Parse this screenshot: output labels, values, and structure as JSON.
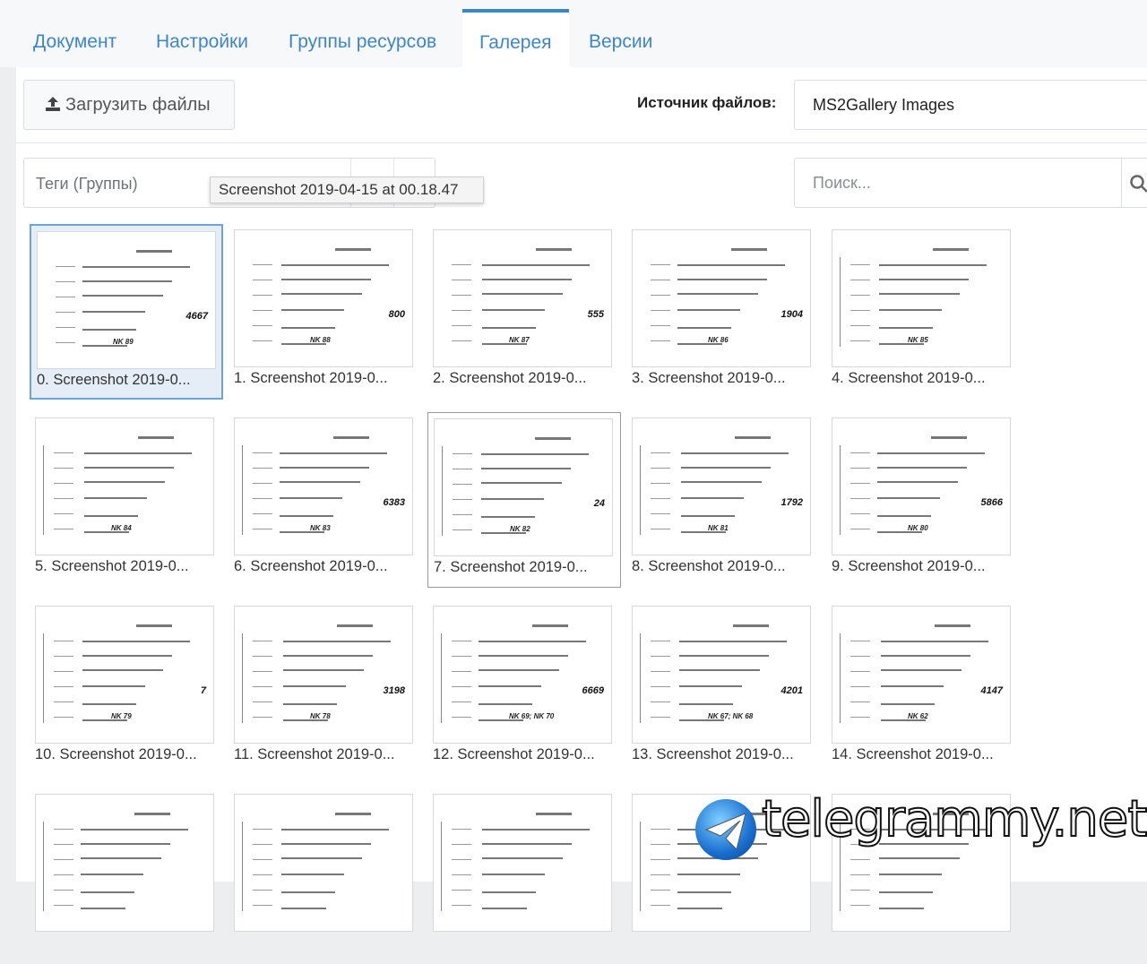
{
  "tabs": [
    {
      "label": "Документ"
    },
    {
      "label": "Настройки"
    },
    {
      "label": "Группы ресурсов"
    },
    {
      "label": "Галерея"
    },
    {
      "label": "Версии"
    }
  ],
  "toolbar": {
    "upload_label": "Загрузить файлы",
    "source_label": "Источник файлов:",
    "source_value": "MS2Gallery Images"
  },
  "filters": {
    "tags_placeholder": "Теги (Группы)",
    "search_placeholder": "Поиск..."
  },
  "tooltip": "Screenshot 2019-04-15 at 00.18.47",
  "gallery": {
    "items": [
      {
        "caption": "0. Screenshot 2019-0...",
        "code": "NK 89",
        "num": "4667"
      },
      {
        "caption": "1. Screenshot 2019-0...",
        "code": "NK 88",
        "num": "800"
      },
      {
        "caption": "2. Screenshot 2019-0...",
        "code": "NK 87",
        "num": "555"
      },
      {
        "caption": "3. Screenshot 2019-0...",
        "code": "NK 86",
        "num": "1904"
      },
      {
        "caption": "4. Screenshot 2019-0...",
        "code": "NK 85",
        "num": ""
      },
      {
        "caption": "5. Screenshot 2019-0...",
        "code": "NK 84",
        "num": ""
      },
      {
        "caption": "6. Screenshot 2019-0...",
        "code": "NK 83",
        "num": "6383"
      },
      {
        "caption": "7. Screenshot 2019-0...",
        "code": "NK 82",
        "num": "24"
      },
      {
        "caption": "8. Screenshot 2019-0...",
        "code": "NK 81",
        "num": "1792"
      },
      {
        "caption": "9. Screenshot 2019-0...",
        "code": "NK 80",
        "num": "5866"
      },
      {
        "caption": "10. Screenshot 2019-0...",
        "code": "NK 79",
        "num": "7"
      },
      {
        "caption": "11. Screenshot 2019-0...",
        "code": "NK 78",
        "num": "3198"
      },
      {
        "caption": "12. Screenshot 2019-0...",
        "code": "NK 69; NK 70",
        "num": "6669"
      },
      {
        "caption": "13. Screenshot 2019-0...",
        "code": "NK 67; NK 68",
        "num": "4201"
      },
      {
        "caption": "14. Screenshot 2019-0...",
        "code": "NK 62",
        "num": "4147"
      },
      {
        "caption": "",
        "code": "",
        "num": ""
      },
      {
        "caption": "",
        "code": "",
        "num": ""
      },
      {
        "caption": "",
        "code": "",
        "num": ""
      },
      {
        "caption": "",
        "code": "",
        "num": ""
      },
      {
        "caption": "",
        "code": "",
        "num": ""
      }
    ],
    "selected_index": 0,
    "hover_index": 7
  },
  "watermark": "telegrammy.net"
}
